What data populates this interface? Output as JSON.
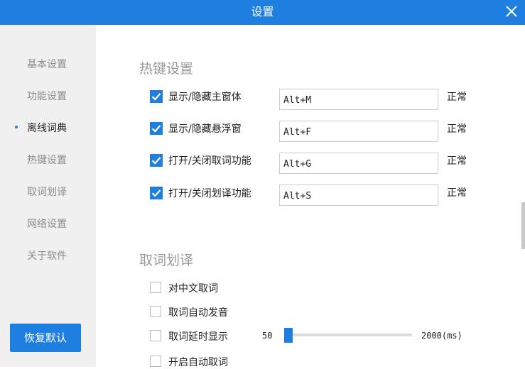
{
  "window": {
    "title": "设置"
  },
  "sidebar": {
    "items": [
      {
        "label": "基本设置",
        "active": false
      },
      {
        "label": "功能设置",
        "active": false
      },
      {
        "label": "离线词典",
        "active": true
      },
      {
        "label": "热键设置",
        "active": false
      },
      {
        "label": "取词划译",
        "active": false
      },
      {
        "label": "网络设置",
        "active": false
      },
      {
        "label": "关于软件",
        "active": false
      }
    ],
    "reset_label": "恢复默认"
  },
  "hotkeys": {
    "title": "热键设置",
    "rows": [
      {
        "label": "显示/隐藏主窗体",
        "checked": true,
        "value": "Alt+M",
        "status": "正常"
      },
      {
        "label": "显示/隐藏悬浮窗",
        "checked": true,
        "value": "Alt+F",
        "status": "正常"
      },
      {
        "label": "打开/关闭取词功能",
        "checked": true,
        "value": "Alt+G",
        "status": "正常"
      },
      {
        "label": "打开/关闭划译功能",
        "checked": true,
        "value": "Alt+S",
        "status": "正常"
      }
    ]
  },
  "capture": {
    "title": "取词划译",
    "options": [
      {
        "label": "对中文取词",
        "checked": false
      },
      {
        "label": "取词自动发音",
        "checked": false
      },
      {
        "label": "取词延时显示",
        "checked": false
      },
      {
        "label": "开启自动取词",
        "checked": false
      }
    ],
    "delay_slider": {
      "min_label": "50",
      "max_label": "2000(ms)",
      "value_fraction": 0.0
    }
  },
  "colors": {
    "accent": "#1e7fe0",
    "sidebar_bg": "#f0f0f0",
    "muted_text": "#8c8c8c"
  }
}
